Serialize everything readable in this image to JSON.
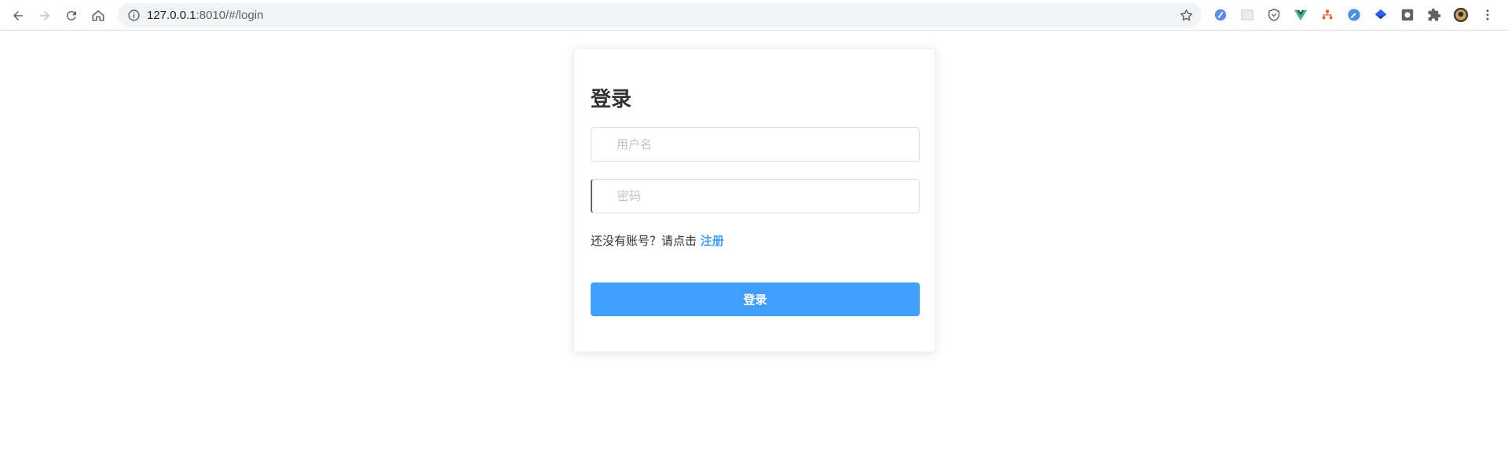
{
  "browser": {
    "url_host": "127.0.0.1",
    "url_rest": ":8010/#/login",
    "icons": [
      "back-icon",
      "forward-icon",
      "reload-icon",
      "home-icon",
      "info-icon",
      "bookmark-star-icon",
      "extensions-puzzle-icon",
      "profile-avatar",
      "menu-kebab-icon"
    ],
    "extension_icons": [
      "ext-blue-circle-icon",
      "ext-grey-square-icon",
      "ext-shield-icon",
      "ext-vue-icon",
      "ext-orange-tree-icon",
      "ext-blue-compass-icon",
      "ext-blue-diamond-icon",
      "ext-grey-box-icon"
    ]
  },
  "login": {
    "title": "登录",
    "username_placeholder": "用户名",
    "password_placeholder": "密码",
    "register_prompt": "还没有账号？请点击",
    "register_link": "注册",
    "submit_label": "登录"
  },
  "colors": {
    "primary": "#409eff",
    "text_primary": "#303133",
    "border": "#dcdfe6",
    "placeholder": "#c0c4cc"
  }
}
